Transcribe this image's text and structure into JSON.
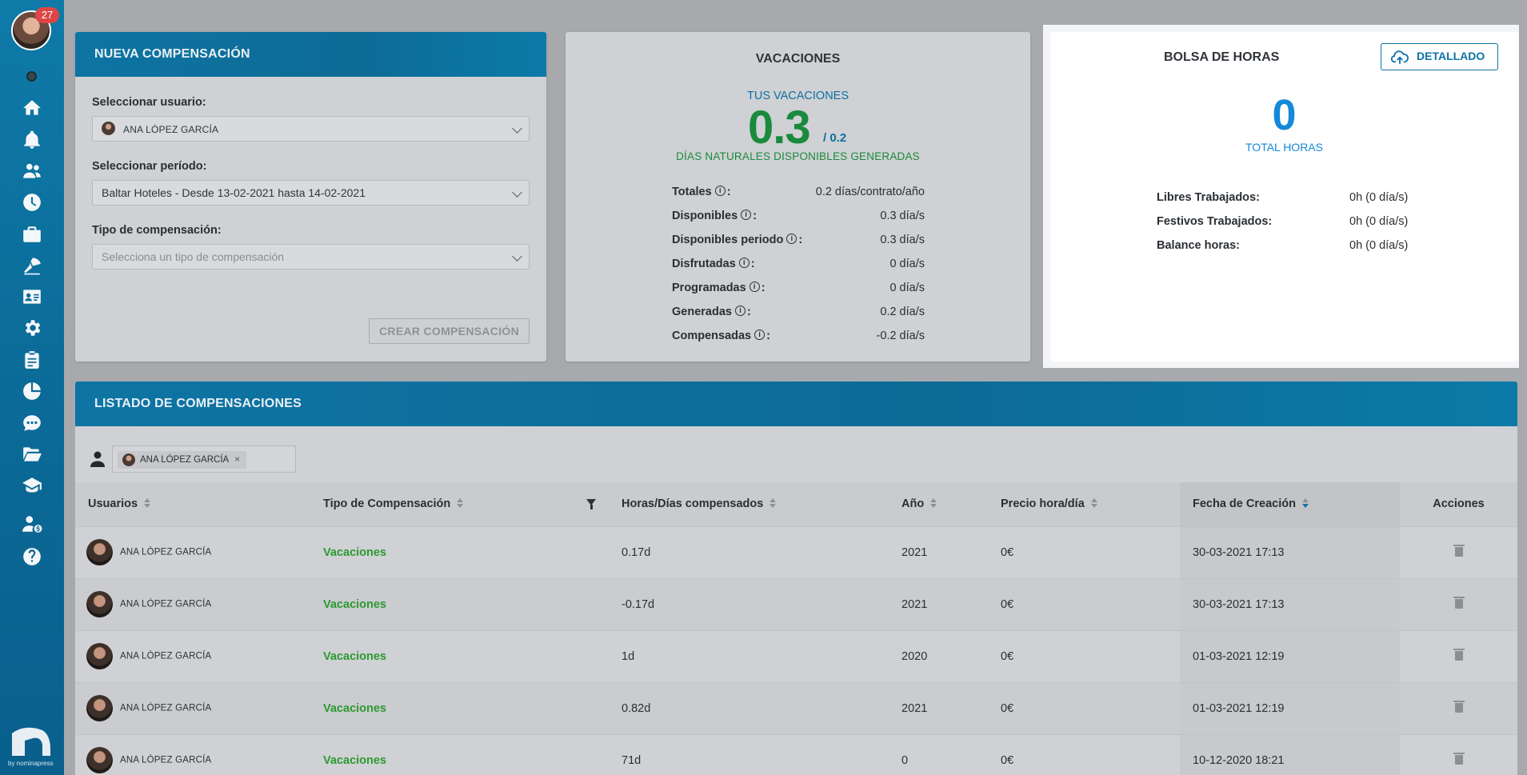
{
  "user": {
    "notifications": "27"
  },
  "brand": {
    "text": "by nominapress"
  },
  "sidebar": {
    "items": [
      {
        "icon": "home-icon"
      },
      {
        "icon": "bell-icon"
      },
      {
        "icon": "users-icon"
      },
      {
        "icon": "clock-icon"
      },
      {
        "icon": "briefcase-icon"
      },
      {
        "icon": "umbrella-beach-icon"
      },
      {
        "icon": "id-card-icon"
      },
      {
        "icon": "gear-icon"
      },
      {
        "icon": "clipboard-icon"
      },
      {
        "icon": "pie-chart-icon"
      },
      {
        "icon": "chat-icon"
      },
      {
        "icon": "folder-open-icon"
      },
      {
        "icon": "graduation-cap-icon"
      },
      {
        "icon": "user-dollar-icon"
      },
      {
        "icon": "help-icon"
      }
    ]
  },
  "nueva": {
    "title": "NUEVA COMPENSACIÓN",
    "user_label": "Seleccionar usuario:",
    "user_value": "ANA LÓPEZ GARCÍA",
    "period_label": "Seleccionar período:",
    "period_value": "Baltar Hoteles - Desde 13-02-2021 hasta 14-02-2021",
    "type_label": "Tipo de compensación:",
    "type_placeholder": "Selecciona un tipo de compensación",
    "create_button": "CREAR COMPENSACIÓN"
  },
  "vacaciones": {
    "title": "VACACIONES",
    "tus": "TUS VACACIONES",
    "available": "0.3",
    "total": "/ 0.2",
    "subtitle": "DÍAS NATURALES DISPONIBLES GENERADAS",
    "rows": [
      {
        "label": "Totales",
        "value": "0.2 días/contrato/año"
      },
      {
        "label": "Disponibles",
        "value": "0.3 día/s"
      },
      {
        "label": "Disponibles periodo",
        "value": "0.3 día/s"
      },
      {
        "label": "Disfrutadas",
        "value": "0 día/s"
      },
      {
        "label": "Programadas",
        "value": "0 día/s"
      },
      {
        "label": "Generadas",
        "value": "0.2 día/s"
      },
      {
        "label": "Compensadas",
        "value": "-0.2 día/s"
      }
    ]
  },
  "bolsa": {
    "title": "BOLSA DE HORAS",
    "detallado": "DETALLADO",
    "total": "0",
    "total_label": "TOTAL HORAS",
    "rows": [
      {
        "label": "Libres Trabajados:",
        "value": "0h (0 día/s)"
      },
      {
        "label": "Festivos Trabajados:",
        "value": "0h (0 día/s)"
      },
      {
        "label": "Balance horas:",
        "value": "0h (0 día/s)"
      }
    ]
  },
  "listado": {
    "title": "LISTADO DE COMPENSACIONES",
    "filter_chip": "ANA LÓPEZ GARCÍA",
    "filter_chip_remove": "×",
    "columns": [
      "Usuarios",
      "Tipo de Compensación",
      "Horas/Días compensados",
      "Año",
      "Precio hora/día",
      "Fecha de Creación",
      "Acciones"
    ],
    "rows": [
      {
        "user": "ANA LÓPEZ GARCÍA",
        "tipo": "Vacaciones",
        "horas": "0.17d",
        "anio": "2021",
        "precio": "0€",
        "fecha": "30-03-2021 17:13"
      },
      {
        "user": "ANA LÓPEZ GARCÍA",
        "tipo": "Vacaciones",
        "horas": "-0.17d",
        "anio": "2021",
        "precio": "0€",
        "fecha": "30-03-2021 17:13"
      },
      {
        "user": "ANA LÓPEZ GARCÍA",
        "tipo": "Vacaciones",
        "horas": "1d",
        "anio": "2020",
        "precio": "0€",
        "fecha": "01-03-2021 12:19"
      },
      {
        "user": "ANA LÓPEZ GARCÍA",
        "tipo": "Vacaciones",
        "horas": "0.82d",
        "anio": "2021",
        "precio": "0€",
        "fecha": "01-03-2021 12:19"
      },
      {
        "user": "ANA LÓPEZ GARCÍA",
        "tipo": "Vacaciones",
        "horas": "71d",
        "anio": "0",
        "precio": "0€",
        "fecha": "10-12-2020 18:21"
      }
    ]
  }
}
